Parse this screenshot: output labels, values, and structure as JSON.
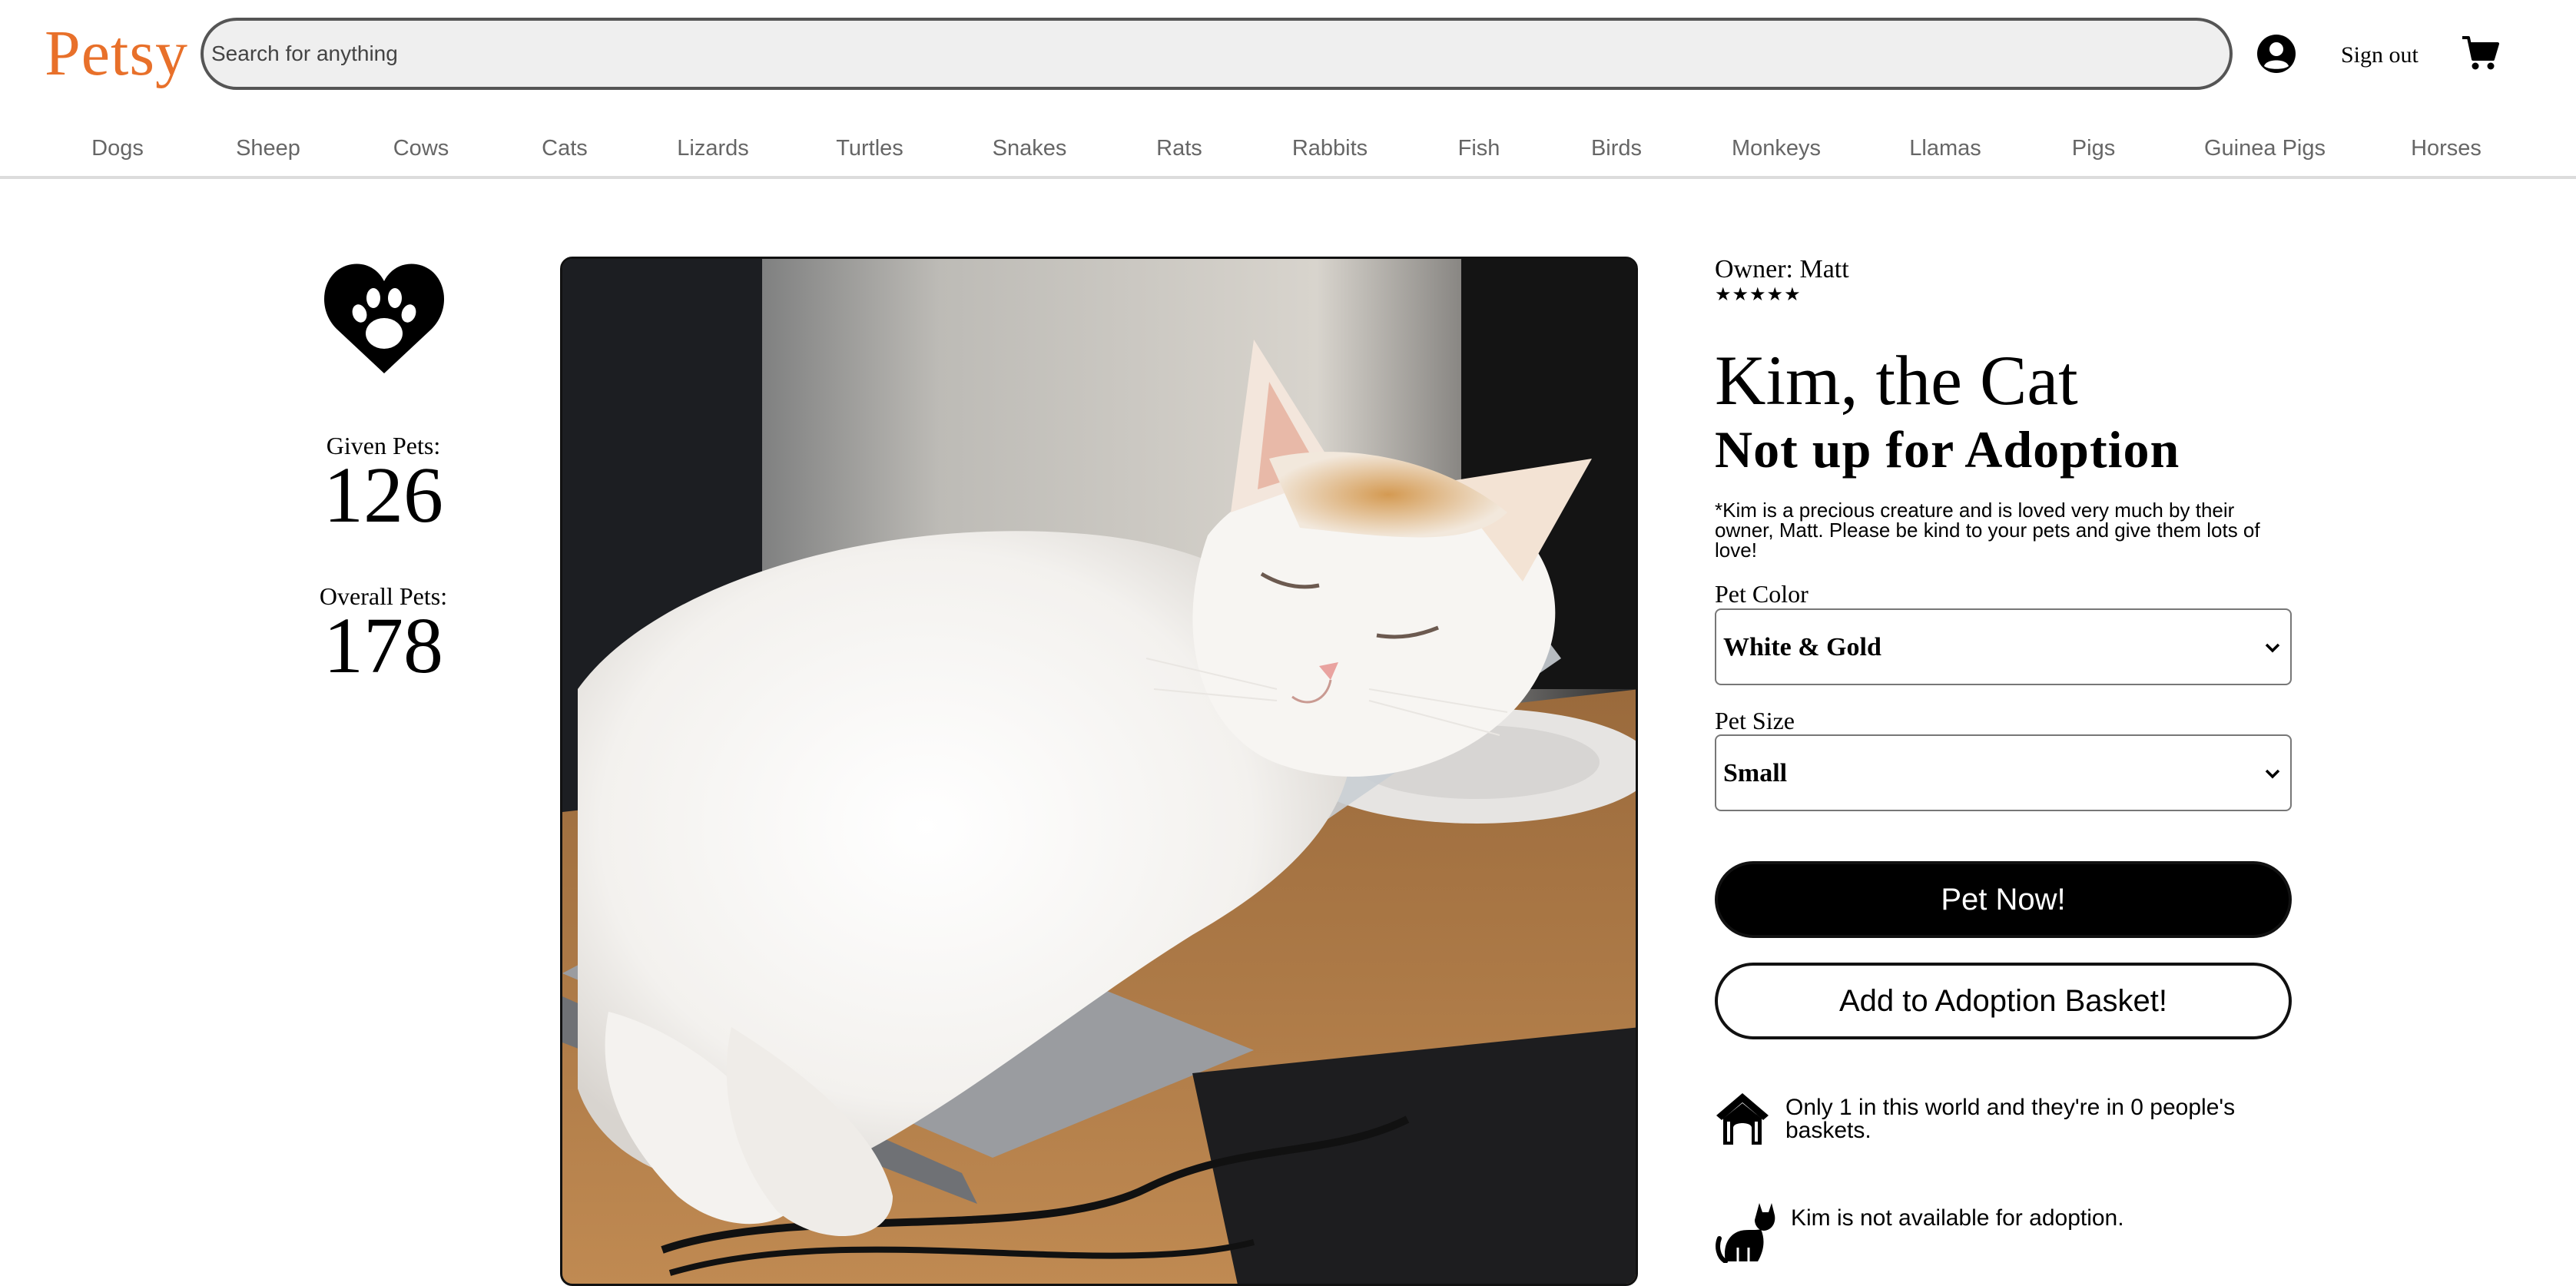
{
  "header": {
    "logo": "Petsy",
    "search_placeholder": "Search for anything",
    "account_icon": "user-circle-icon",
    "sign_out_label": "Sign out",
    "cart_icon": "shopping-cart-icon"
  },
  "categories": [
    "Dogs",
    "Sheep",
    "Cows",
    "Cats",
    "Lizards",
    "Turtles",
    "Snakes",
    "Rats",
    "Rabbits",
    "Fish",
    "Birds",
    "Monkeys",
    "Llamas",
    "Pigs",
    "Guinea Pigs",
    "Horses"
  ],
  "stats": {
    "icon": "heart-paw-icon",
    "given_label": "Given Pets:",
    "given_value": "126",
    "overall_label": "Overall Pets:",
    "overall_value": "178"
  },
  "product": {
    "photo": "sleeping-white-cat-photo",
    "owner_label": "Owner: Matt",
    "stars": "★★★★★",
    "rating": 5,
    "title": "Kim, the Cat",
    "status": "Not up for Adoption",
    "description": "*Kim is a precious creature and is loved very much by their owner, Matt. Please be kind to your pets and give them lots of love!",
    "color_label": "Pet Color",
    "color_value": "White & Gold",
    "size_label": "Pet Size",
    "size_value": "Small",
    "primary_button": "Pet Now!",
    "secondary_button": "Add to Adoption Basket!",
    "info": [
      {
        "icon": "dog-house-icon",
        "text": "Only 1 in this world and they're in 0 people's baskets."
      },
      {
        "icon": "cat-icon",
        "text": "Kim is not available for adoption."
      }
    ]
  },
  "colors": {
    "brand": "#e8702a",
    "button_primary_bg": "#000000",
    "search_bg": "#efefef",
    "nav_text": "#666666"
  }
}
